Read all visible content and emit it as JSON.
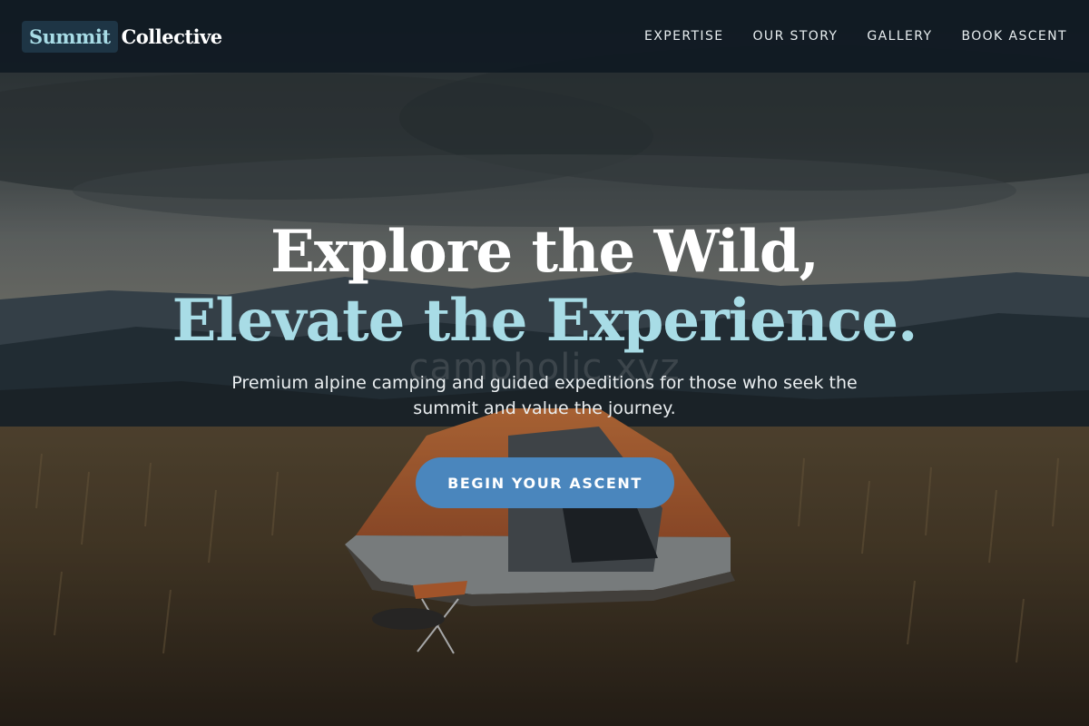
{
  "brand": {
    "part1": "Summit",
    "part2": "Collective"
  },
  "nav": {
    "items": [
      "EXPERTISE",
      "OUR STORY",
      "GALLERY",
      "BOOK ASCENT"
    ]
  },
  "hero": {
    "headline_line1": "Explore the Wild,",
    "headline_line2": "Elevate the Experience.",
    "watermark": "campholic.xyz",
    "subtitle": "Premium alpine camping and guided expeditions for those who seek the summit and value the journey.",
    "cta_label": "BEGIN YOUR ASCENT"
  },
  "colors": {
    "accent": "#a8dce6",
    "button": "#4a86bd",
    "navbar": "#101a22",
    "tent_orange": "#c4692c"
  }
}
